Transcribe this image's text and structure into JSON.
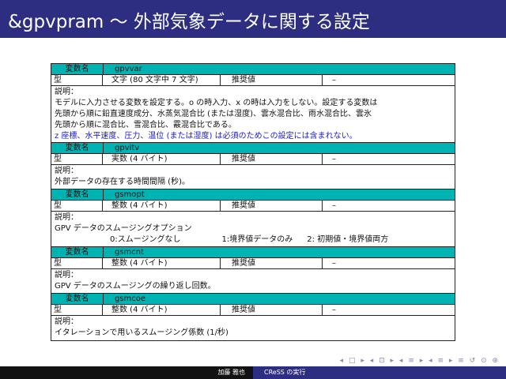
{
  "slide": {
    "title": "&gpvpram ～ 外部気象データに関する設定"
  },
  "blocks": [
    {
      "head_label": "変数名",
      "name": "gpvvar",
      "type_label": "型",
      "type_value": "文字 (80 文字中 7 文字)",
      "default_label": "推奨値",
      "default_value": "–",
      "desc_label": "説明：",
      "desc_lines": [
        "モデルに入力させる変数を設定する。o の時入力、x の時は入力をしない。設定する変数は",
        "先頭から順に鉛直速度成分、水蒸気混合比 (または湿度)、雲水混合比、雨水混合比、雲氷",
        "先頭から順に混合比、雪混合比、霰混合比である。"
      ],
      "desc_note": "z 座標、水平速度、圧力、温位 (または湿度) は必須のためこの設定には含まれない。"
    },
    {
      "head_label": "変数名",
      "name": "gpvitv",
      "type_label": "型",
      "type_value": "実数 (4 バイト)",
      "default_label": "推奨値",
      "default_value": "–",
      "desc_label": "説明：",
      "desc_lines": [
        "外部データの存在する時間間隔 (秒)。"
      ]
    },
    {
      "head_label": "変数名",
      "name": "gsmopt",
      "type_label": "型",
      "type_value": "整数 (4 バイト)",
      "default_label": "推奨値",
      "default_value": "–",
      "desc_label": "説明：",
      "desc_lines": [
        "GPV データのスムージングオプション"
      ],
      "options": [
        "0:スムージングなし",
        "1:境界値データのみ",
        "2: 初期値・境界値両方"
      ]
    },
    {
      "head_label": "変数名",
      "name": "gsmcnt",
      "type_label": "型",
      "type_value": "整数 (4 バイト)",
      "default_label": "推奨値",
      "default_value": "–",
      "desc_label": "説明：",
      "desc_lines": [
        "GPV データのスムージングの繰り返し回数。"
      ]
    },
    {
      "head_label": "変数名",
      "name": "gsmcoe",
      "type_label": "型",
      "type_value": "整数 (4 バイト)",
      "default_label": "推奨値",
      "default_value": "–",
      "desc_label": "説明：",
      "desc_lines": [
        "イタレーションで用いるスムージング係数 (1/秒)"
      ]
    }
  ],
  "nav": {
    "symbols": "◂ □ ▸ ◂ ⊡ ▸ ◂ ≡ ▸ ◂ ≡ ▸ ≡ ↺ ⊙ ⊕"
  },
  "footer": {
    "author": "加藤 雅也",
    "section": "CReSS の実行"
  },
  "colors": {
    "title_bar": "#2d2d82",
    "header_row": "#00b3b3",
    "note_text": "#1a1acc"
  }
}
